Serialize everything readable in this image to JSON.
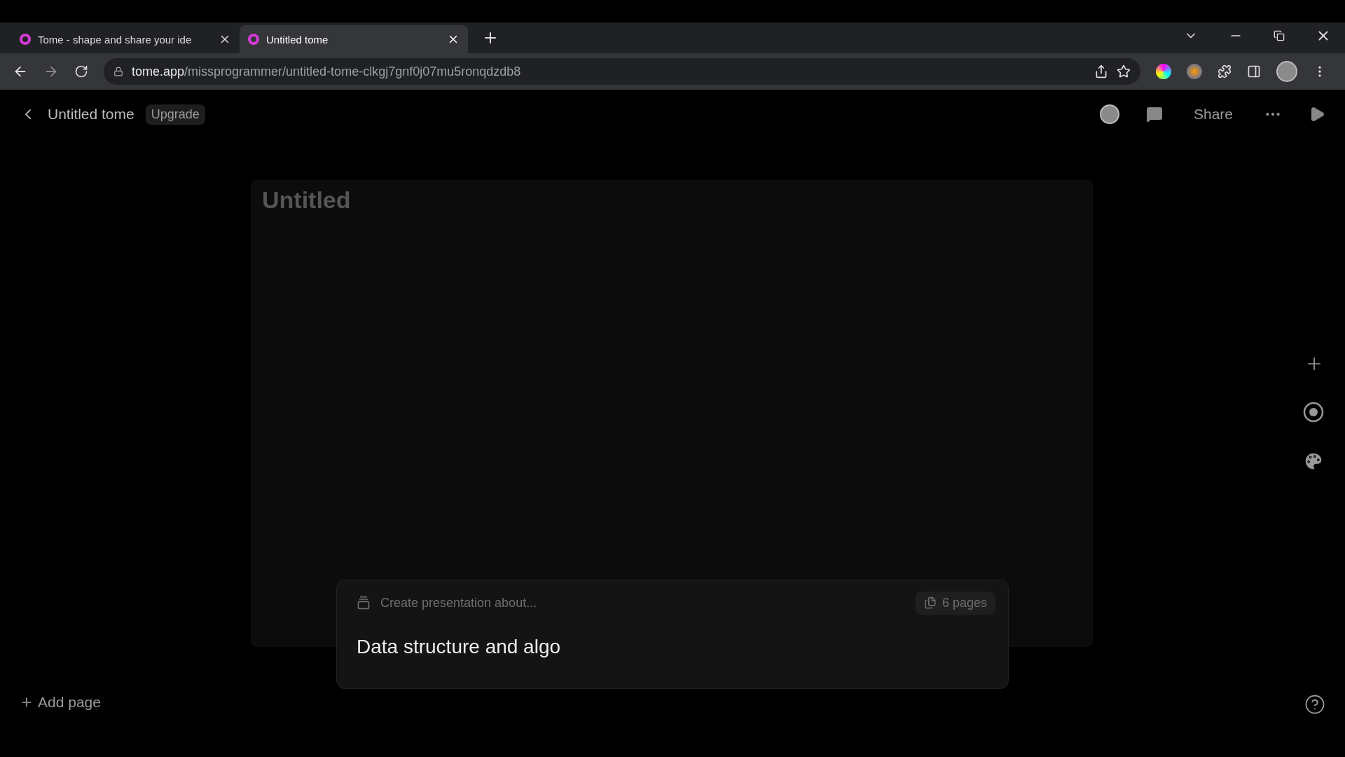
{
  "browser": {
    "tabs": [
      {
        "title": "Tome - shape and share your ide",
        "selected": false
      },
      {
        "title": "Untitled tome",
        "selected": true
      }
    ],
    "url_host": "tome.app",
    "url_path": "/missprogrammer/untitled-tome-clkgj7gnf0j07mu5ronqdzdb8"
  },
  "header": {
    "title": "Untitled tome",
    "badge": "Upgrade",
    "share": "Share"
  },
  "page": {
    "title": "Untitled"
  },
  "prompt": {
    "label": "Create presentation about...",
    "pages": "6 pages",
    "value": "Data structure and algo"
  },
  "footer": {
    "add_page": "Add page"
  }
}
